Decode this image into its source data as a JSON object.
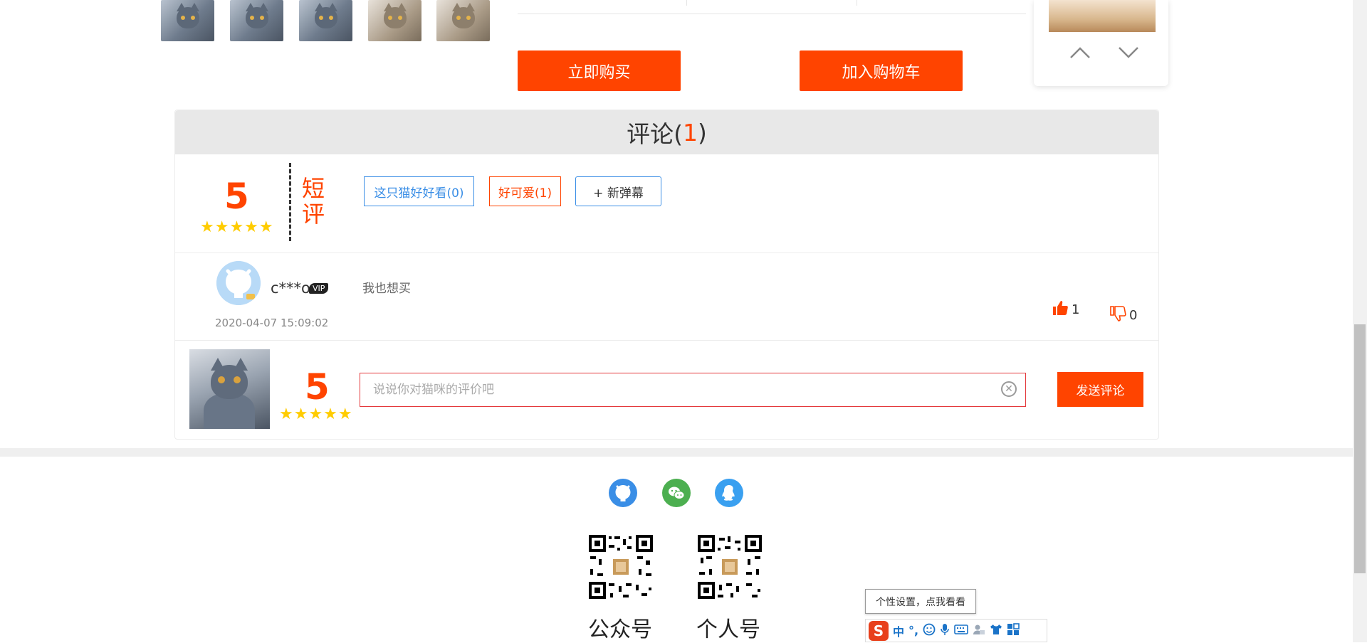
{
  "gallery": {
    "thumbs": [
      "cat-thumb-1",
      "cat-thumb-2",
      "cat-thumb-3",
      "cat-thumb-4",
      "cat-thumb-5"
    ]
  },
  "product_actions": {
    "buy_now": "立即购买",
    "add_to_cart": "加入购物车"
  },
  "comments": {
    "title": "评论(",
    "count": "1",
    "title_close": ")",
    "summary": {
      "score": "5",
      "stars": "★★★★★",
      "short_label": "短评",
      "tags": [
        {
          "label": "这只猫好好看(0)"
        },
        {
          "label": "好可爱(1)"
        }
      ],
      "new_tag_label": "+ 新弹幕"
    },
    "items": [
      {
        "username": "c***o",
        "badge": "VIP",
        "text": "我也想买",
        "date": "2020-04-07 15:09:02",
        "likes": "1",
        "dislikes": "0"
      }
    ],
    "compose": {
      "score": "5",
      "stars": "★★★★★",
      "placeholder": "说说你对猫咪的评价吧",
      "send_label": "发送评论"
    }
  },
  "footer": {
    "qr_labels": [
      "公众号",
      "个人号"
    ]
  },
  "ime": {
    "tooltip": "个性设置，点我看看",
    "mode": "中",
    "punct": "°,"
  },
  "colors": {
    "accent": "#ff4400",
    "link_blue": "#3a8ee6",
    "star": "#ffcc00"
  }
}
